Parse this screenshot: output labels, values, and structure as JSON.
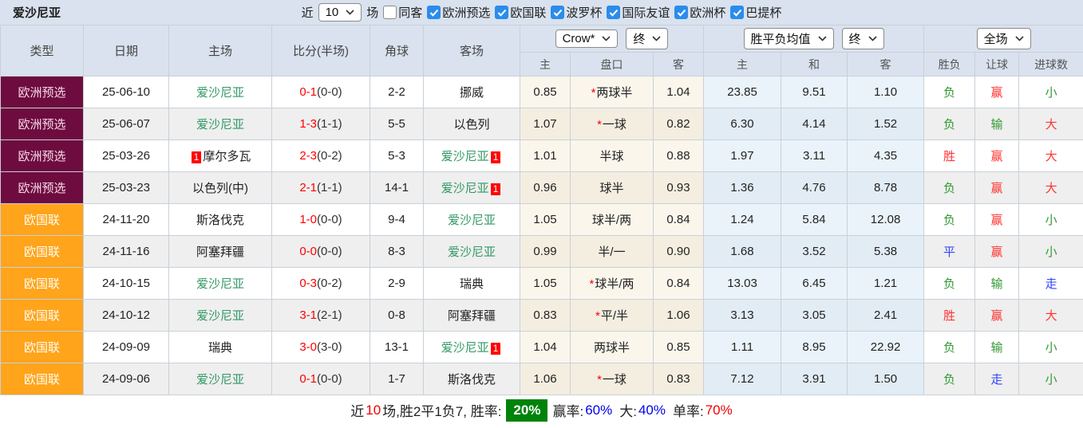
{
  "topbar": {
    "title": "爱沙尼亚",
    "filter": {
      "near_label": "近",
      "near_value": "10",
      "games_label": "场",
      "same_away": {
        "label": "同客",
        "checked": false
      },
      "competitions": [
        {
          "label": "欧洲预选",
          "checked": true
        },
        {
          "label": "欧国联",
          "checked": true
        },
        {
          "label": "波罗杯",
          "checked": true
        },
        {
          "label": "国际友谊",
          "checked": true
        },
        {
          "label": "欧洲杯",
          "checked": true
        },
        {
          "label": "巴提杯",
          "checked": true
        }
      ]
    }
  },
  "table": {
    "main_headers": [
      "类型",
      "日期",
      "主场",
      "比分(半场)",
      "角球",
      "客场"
    ],
    "selectors": {
      "odds_company": "Crow*",
      "odds_stage": "终",
      "avg_type": "胜平负均值",
      "avg_stage": "终",
      "scope": "全场"
    },
    "sub_headers": [
      "主",
      "盘口",
      "客",
      "主",
      "和",
      "客",
      "胜负",
      "让球",
      "进球数"
    ],
    "rows": [
      {
        "type": "欧洲预选",
        "type_style": "maroon",
        "date": "25-06-10",
        "home": {
          "name": "爱沙尼亚",
          "self": true,
          "badge": null
        },
        "score": {
          "ft": "0-1",
          "ht": "(0-0)"
        },
        "corner": "2-2",
        "away": {
          "name": "挪威",
          "self": false,
          "badge": null
        },
        "odds": {
          "home": "0.85",
          "star": true,
          "handicap": "两球半",
          "away": "1.04"
        },
        "avg": {
          "win": "23.85",
          "draw": "9.51",
          "lose": "1.10"
        },
        "results": [
          {
            "t": "负",
            "c": "green"
          },
          {
            "t": "赢",
            "c": "red"
          },
          {
            "t": "小",
            "c": "green"
          }
        ]
      },
      {
        "type": "欧洲预选",
        "type_style": "maroon",
        "date": "25-06-07",
        "home": {
          "name": "爱沙尼亚",
          "self": true,
          "badge": null
        },
        "score": {
          "ft": "1-3",
          "ht": "(1-1)"
        },
        "corner": "5-5",
        "away": {
          "name": "以色列",
          "self": false,
          "badge": null
        },
        "odds": {
          "home": "1.07",
          "star": true,
          "handicap": "一球",
          "away": "0.82"
        },
        "avg": {
          "win": "6.30",
          "draw": "4.14",
          "lose": "1.52"
        },
        "results": [
          {
            "t": "负",
            "c": "green"
          },
          {
            "t": "输",
            "c": "green"
          },
          {
            "t": "大",
            "c": "red"
          }
        ]
      },
      {
        "type": "欧洲预选",
        "type_style": "maroon",
        "date": "25-03-26",
        "home": {
          "name": "摩尔多瓦",
          "self": false,
          "badge": "1"
        },
        "score": {
          "ft": "2-3",
          "ht": "(0-2)"
        },
        "corner": "5-3",
        "away": {
          "name": "爱沙尼亚",
          "self": true,
          "badge": "1"
        },
        "odds": {
          "home": "1.01",
          "star": false,
          "handicap": "半球",
          "away": "0.88"
        },
        "avg": {
          "win": "1.97",
          "draw": "3.11",
          "lose": "4.35"
        },
        "results": [
          {
            "t": "胜",
            "c": "red"
          },
          {
            "t": "赢",
            "c": "red"
          },
          {
            "t": "大",
            "c": "red"
          }
        ]
      },
      {
        "type": "欧洲预选",
        "type_style": "maroon",
        "date": "25-03-23",
        "home": {
          "name": "以色列(中)",
          "self": false,
          "badge": null
        },
        "score": {
          "ft": "2-1",
          "ht": "(1-1)"
        },
        "corner": "14-1",
        "away": {
          "name": "爱沙尼亚",
          "self": true,
          "badge": "1"
        },
        "odds": {
          "home": "0.96",
          "star": false,
          "handicap": "球半",
          "away": "0.93"
        },
        "avg": {
          "win": "1.36",
          "draw": "4.76",
          "lose": "8.78"
        },
        "results": [
          {
            "t": "负",
            "c": "green"
          },
          {
            "t": "赢",
            "c": "red"
          },
          {
            "t": "大",
            "c": "red"
          }
        ]
      },
      {
        "type": "欧国联",
        "type_style": "orange",
        "date": "24-11-20",
        "home": {
          "name": "斯洛伐克",
          "self": false,
          "badge": null
        },
        "score": {
          "ft": "1-0",
          "ht": "(0-0)"
        },
        "corner": "9-4",
        "away": {
          "name": "爱沙尼亚",
          "self": true,
          "badge": null
        },
        "odds": {
          "home": "1.05",
          "star": false,
          "handicap": "球半/两",
          "away": "0.84"
        },
        "avg": {
          "win": "1.24",
          "draw": "5.84",
          "lose": "12.08"
        },
        "results": [
          {
            "t": "负",
            "c": "green"
          },
          {
            "t": "赢",
            "c": "red"
          },
          {
            "t": "小",
            "c": "green"
          }
        ]
      },
      {
        "type": "欧国联",
        "type_style": "orange",
        "date": "24-11-16",
        "home": {
          "name": "阿塞拜疆",
          "self": false,
          "badge": null
        },
        "score": {
          "ft": "0-0",
          "ht": "(0-0)"
        },
        "corner": "8-3",
        "away": {
          "name": "爱沙尼亚",
          "self": true,
          "badge": null
        },
        "odds": {
          "home": "0.99",
          "star": false,
          "handicap": "半/一",
          "away": "0.90"
        },
        "avg": {
          "win": "1.68",
          "draw": "3.52",
          "lose": "5.38"
        },
        "results": [
          {
            "t": "平",
            "c": "blue"
          },
          {
            "t": "赢",
            "c": "red"
          },
          {
            "t": "小",
            "c": "green"
          }
        ]
      },
      {
        "type": "欧国联",
        "type_style": "orange",
        "date": "24-10-15",
        "home": {
          "name": "爱沙尼亚",
          "self": true,
          "badge": null
        },
        "score": {
          "ft": "0-3",
          "ht": "(0-2)"
        },
        "corner": "2-9",
        "away": {
          "name": "瑞典",
          "self": false,
          "badge": null
        },
        "odds": {
          "home": "1.05",
          "star": true,
          "handicap": "球半/两",
          "away": "0.84"
        },
        "avg": {
          "win": "13.03",
          "draw": "6.45",
          "lose": "1.21"
        },
        "results": [
          {
            "t": "负",
            "c": "green"
          },
          {
            "t": "输",
            "c": "green"
          },
          {
            "t": "走",
            "c": "blue"
          }
        ]
      },
      {
        "type": "欧国联",
        "type_style": "orange",
        "date": "24-10-12",
        "home": {
          "name": "爱沙尼亚",
          "self": true,
          "badge": null
        },
        "score": {
          "ft": "3-1",
          "ht": "(2-1)"
        },
        "corner": "0-8",
        "away": {
          "name": "阿塞拜疆",
          "self": false,
          "badge": null
        },
        "odds": {
          "home": "0.83",
          "star": true,
          "handicap": "平/半",
          "away": "1.06"
        },
        "avg": {
          "win": "3.13",
          "draw": "3.05",
          "lose": "2.41"
        },
        "results": [
          {
            "t": "胜",
            "c": "red"
          },
          {
            "t": "赢",
            "c": "red"
          },
          {
            "t": "大",
            "c": "red"
          }
        ]
      },
      {
        "type": "欧国联",
        "type_style": "orange",
        "date": "24-09-09",
        "home": {
          "name": "瑞典",
          "self": false,
          "badge": null
        },
        "score": {
          "ft": "3-0",
          "ht": "(3-0)"
        },
        "corner": "13-1",
        "away": {
          "name": "爱沙尼亚",
          "self": true,
          "badge": "1"
        },
        "odds": {
          "home": "1.04",
          "star": false,
          "handicap": "两球半",
          "away": "0.85"
        },
        "avg": {
          "win": "1.11",
          "draw": "8.95",
          "lose": "22.92"
        },
        "results": [
          {
            "t": "负",
            "c": "green"
          },
          {
            "t": "输",
            "c": "green"
          },
          {
            "t": "小",
            "c": "green"
          }
        ]
      },
      {
        "type": "欧国联",
        "type_style": "orange",
        "date": "24-09-06",
        "home": {
          "name": "爱沙尼亚",
          "self": true,
          "badge": null
        },
        "score": {
          "ft": "0-1",
          "ht": "(0-0)"
        },
        "corner": "1-7",
        "away": {
          "name": "斯洛伐克",
          "self": false,
          "badge": null
        },
        "odds": {
          "home": "1.06",
          "star": true,
          "handicap": "一球",
          "away": "0.83"
        },
        "avg": {
          "win": "7.12",
          "draw": "3.91",
          "lose": "1.50"
        },
        "results": [
          {
            "t": "负",
            "c": "green"
          },
          {
            "t": "走",
            "c": "blue"
          },
          {
            "t": "小",
            "c": "green"
          }
        ]
      }
    ]
  },
  "summary": {
    "near_label": "近",
    "near_count": "10",
    "record": "场,胜2平1负7, 胜率:",
    "win_rate": "20%",
    "odds_win_label": "赢率:",
    "odds_win": "60%",
    "big_label": "大:",
    "big": "40%",
    "single_label": "单率:",
    "single": "70%"
  },
  "colors": {
    "type_maroon": "#6e0c3f",
    "type_orange": "#ffa41b",
    "self_team_green": "#339966",
    "score_red": "#ff0000",
    "result_green": "#339933",
    "result_red": "#ff3333",
    "result_blue": "#3344ff",
    "header_bg": "#d9e2ee",
    "checkbox_blue": "#2b8ceb",
    "win_rate_bg": "#00830a",
    "stat_blue": "#0000ee",
    "stat_red": "#ee0000"
  }
}
